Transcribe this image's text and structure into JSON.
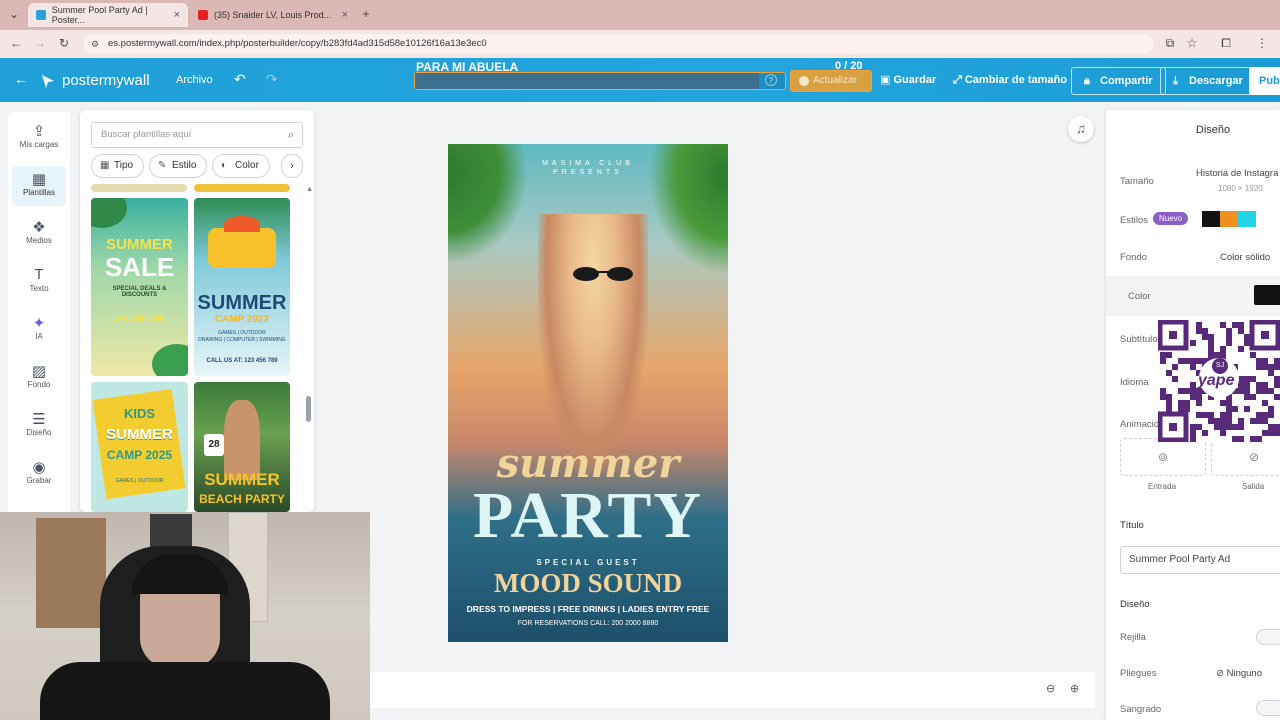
{
  "browser": {
    "tabs": [
      {
        "title": "Summer Pool Party Ad | Poster..."
      },
      {
        "title": "(35) Snaider LV, Louis Prod..."
      }
    ],
    "new_tab": "+",
    "close": "×",
    "url": "es.postermywall.com/index.php/posterbuilder/copy/b283fd4ad315d58e10126f16a13e3ec0"
  },
  "header": {
    "logo": "postermywall",
    "archivo": "Archivo",
    "doc_name": "PARA MI ABUELA",
    "counter": "0 / 20",
    "progress": 0.93,
    "help": "?",
    "actualizar": "Actualizar",
    "guardar": "Guardar",
    "cambiar": "Cambiar de tamaño",
    "compartir": "Compartir",
    "descargar": "Descargar",
    "publicar": "Publ"
  },
  "rail": [
    {
      "label": "Mis cargas",
      "icon": "upload-icon",
      "glyph": "⇪"
    },
    {
      "label": "Plantillas",
      "icon": "templates-icon",
      "glyph": "▦"
    },
    {
      "label": "Medios",
      "icon": "media-icon",
      "glyph": "❖"
    },
    {
      "label": "Texto",
      "icon": "text-icon",
      "glyph": "T"
    },
    {
      "label": "IA",
      "icon": "ai-icon",
      "glyph": "✦"
    },
    {
      "label": "Fondo",
      "icon": "background-icon",
      "glyph": "▨"
    },
    {
      "label": "Diseño",
      "icon": "layout-icon",
      "glyph": "☰"
    },
    {
      "label": "Grabar",
      "icon": "record-icon",
      "glyph": "◉"
    }
  ],
  "panel": {
    "search_placeholder": "Buscar plantillas aquí",
    "chips": [
      "Tipo",
      "Estilo",
      "Color"
    ],
    "next": "›",
    "templates": [
      {
        "line1": "SUMMER",
        "line2": "SALE",
        "line3": "SPECIAL DEALS & DISCOUNTS",
        "line4": "070 390 8000"
      },
      {
        "line1": "SUMMER",
        "line2": "CAMP 2022",
        "line3": "GAMES | OUTDOOR",
        "line4": "DRAWING | COMPUTER | SWIMMING",
        "line5": "CALL US AT: 123 456 789"
      },
      {
        "line1": "KIDS",
        "line2": "SUMMER",
        "line3": "CAMP 2025",
        "line4": "GAMES | OUTDOOR"
      },
      {
        "line1": "28",
        "line2": "SUMMER",
        "line3": "BEACH PARTY"
      }
    ]
  },
  "poster": {
    "top1": "MASIMA CLUB",
    "top2": "PRESENTS",
    "script": "summer",
    "main": "PARTY",
    "guest": "SPECIAL GUEST",
    "artist": "MOOD SOUND",
    "info": "DRESS TO IMPRESS | FREE DRINKS | LADIES ENTRY FREE",
    "reservations": "FOR RESERVATIONS CALL: 200 2000 8880"
  },
  "right": {
    "title": "Diseño",
    "tamano_label": "Tamaño",
    "tamano_value": "Historia de Instagra",
    "tamano_dims": "1080 × 1920",
    "estilos_label": "Estilos",
    "nuevo": "Nuevo",
    "fondo_label": "Fondo",
    "fondo_value": "Color sólido",
    "color_label": "Color",
    "subtitle_label": "Subtítulo",
    "idioma_label": "Idioma",
    "animacion_label": "Animación",
    "entrada": "Entrada",
    "salida": "Salida",
    "titulo_label": "Título",
    "titulo_value": "Summer Pool Party Ad",
    "diseno_label": "Diseño",
    "rejilla": "Rejilla",
    "pliegues": "Pliegues",
    "pliegues_value": "Ninguno",
    "sangrado": "Sangrado",
    "qr_text": "yape",
    "qr_badge": "SJ"
  },
  "colors": {
    "header": "#22a4dc",
    "tabbar": "#d9b8b6",
    "swatch1": "#111111",
    "swatch2": "#f0901c",
    "swatch3": "#22d4e8",
    "qr": "#5a2a7a"
  }
}
